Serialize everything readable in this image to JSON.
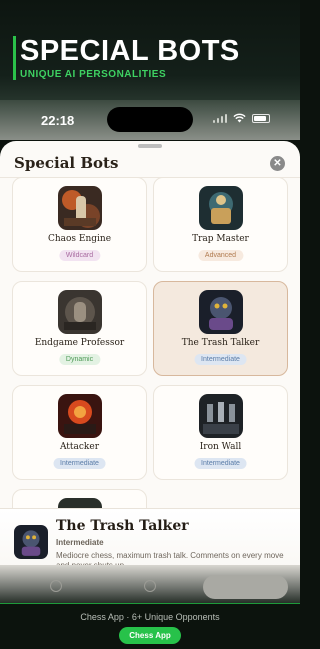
{
  "promo": {
    "title": "SPECIAL BOTS",
    "subtitle": "UNIQUE AI PERSONALITIES"
  },
  "status_bar": {
    "time": "22:18",
    "icons": [
      "signal-icon",
      "wifi-icon",
      "battery-icon"
    ]
  },
  "sheet": {
    "title": "Special Bots",
    "close_icon": "close-icon"
  },
  "bots": [
    {
      "name": "Chaos Engine",
      "badge": "Wildcard",
      "badge_bg": "#f2e3f1",
      "badge_fg": "#a86aa0"
    },
    {
      "name": "Trap Master",
      "badge": "Advanced",
      "badge_bg": "#f7eadf",
      "badge_fg": "#b07a4e"
    },
    {
      "name": "Endgame Professor",
      "badge": "Dynamic",
      "badge_bg": "#e3f2e3",
      "badge_fg": "#4e9a56"
    },
    {
      "name": "The Trash Talker",
      "badge": "Intermediate",
      "badge_bg": "#dde6f2",
      "badge_fg": "#5b7da8"
    },
    {
      "name": "Attacker",
      "badge": "Intermediate",
      "badge_bg": "#dde6f2",
      "badge_fg": "#5b7da8"
    },
    {
      "name": "Iron Wall",
      "badge": "Intermediate",
      "badge_bg": "#dde6f2",
      "badge_fg": "#5b7da8"
    }
  ],
  "selected": {
    "name": "The Trash Talker",
    "level": "Intermediate",
    "description": "Mediocre chess, maximum trash talk. Comments on every move and never shuts up."
  },
  "footer": {
    "text": "Chess App · 6+ Unique Opponents",
    "cta": "Chess App"
  },
  "colors": {
    "accent": "#27c24a",
    "selected_card_bg": "#f4e9de",
    "selected_card_border": "#d7b89d"
  }
}
